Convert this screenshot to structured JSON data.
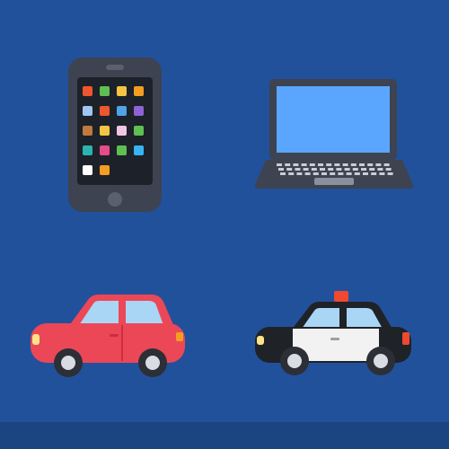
{
  "theme": {
    "background": "#22519b",
    "bottom_bar": "#1b4580"
  },
  "icons": [
    {
      "id": "phone",
      "name": "mobile-phone-icon"
    },
    {
      "id": "laptop",
      "name": "laptop-icon"
    },
    {
      "id": "car",
      "name": "red-car-icon"
    },
    {
      "id": "police",
      "name": "police-car-icon"
    }
  ],
  "colors": {
    "phone_body": "#3d4350",
    "phone_screen": "#1d2129",
    "app_colors": [
      "#f0562d",
      "#5fbf52",
      "#f4c542",
      "#f59c22",
      "#9ec6f0",
      "#f0562d",
      "#4fa3e6",
      "#8e63d6",
      "#c2793e",
      "#f4c542",
      "#f0c6e4",
      "#5fbf52",
      "#2bb3b1",
      "#e84a8c",
      "#5fbf52",
      "#36b3f0",
      "#ffffff",
      "#f59c22"
    ],
    "laptop_body": "#3d4350",
    "laptop_screen": "#5aa6ff",
    "car_body": "#ec4757",
    "car_window": "#a9d6f5",
    "police_black": "#1f2227",
    "police_white": "#f2f2f2",
    "police_light": "#f0492f",
    "tire": "#2c2f36",
    "hub": "#d9dde3"
  }
}
